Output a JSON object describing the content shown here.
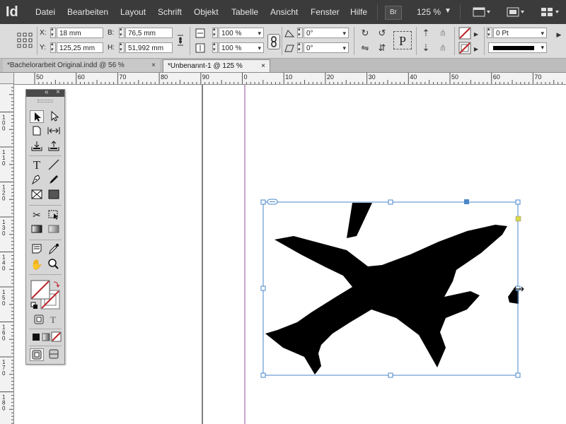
{
  "app": {
    "logo": "Id"
  },
  "menu": {
    "items": [
      "Datei",
      "Bearbeiten",
      "Layout",
      "Schrift",
      "Objekt",
      "Tabelle",
      "Ansicht",
      "Fenster",
      "Hilfe"
    ],
    "bridge_label": "Br",
    "zoom": "125 %"
  },
  "control": {
    "x_label": "X:",
    "x_value": "18 mm",
    "y_label": "Y:",
    "y_value": "125,25 mm",
    "w_label": "B:",
    "w_value": "76,5 mm",
    "h_label": "H:",
    "h_value": "51,992 mm",
    "scale_x": "100 %",
    "scale_y": "100 %",
    "rotate": "0°",
    "shear": "0°",
    "stroke_weight": "0 Pt"
  },
  "tabs": [
    {
      "label": "*Bachelorarbeit Original.indd @ 56 %",
      "close": "×",
      "active": false
    },
    {
      "label": "*Unbenannt-1 @ 125 %",
      "close": "×",
      "active": true
    }
  ],
  "ruler": {
    "h_labels": [
      "50",
      "60",
      "70",
      "80",
      "90",
      "0",
      "10",
      "20",
      "30",
      "40",
      "50",
      "60",
      "70",
      "80",
      "90",
      "100"
    ],
    "v_labels": [
      "9",
      "1 0 0",
      "1 1 0",
      "1 2 0",
      "1 3 0",
      "1 4 0",
      "1 5 0",
      "1 6 0",
      "1 7 0",
      "1 8 0"
    ]
  },
  "colors": {
    "menubar": "#3b3b3b",
    "selection": "#4a86c8",
    "guide": "#9b4a9b",
    "anchor": "#d8d84a",
    "none_swatch": "#c0272d"
  },
  "icons": {
    "selection": "selection-tool-icon",
    "direct_selection": "direct-selection-tool-icon",
    "page": "page-tool-icon",
    "gap": "gap-tool-icon",
    "content_collector": "content-collector-icon",
    "content_placer": "content-placer-icon",
    "type": "type-tool-icon",
    "line": "line-tool-icon",
    "pen": "pen-tool-icon",
    "pencil": "pencil-tool-icon",
    "rect_frame": "rectangle-frame-tool-icon",
    "rect": "rectangle-tool-icon",
    "scissors": "scissors-tool-icon",
    "free_transform": "free-transform-tool-icon",
    "gradient_swatch": "gradient-swatch-tool-icon",
    "gradient_feather": "gradient-feather-tool-icon",
    "note": "note-tool-icon",
    "eyedropper": "eyedropper-tool-icon",
    "hand": "hand-tool-icon",
    "zoom": "zoom-tool-icon"
  },
  "tools_panel": {
    "collapse": "«",
    "close": "×",
    "type_toggle": "T"
  }
}
